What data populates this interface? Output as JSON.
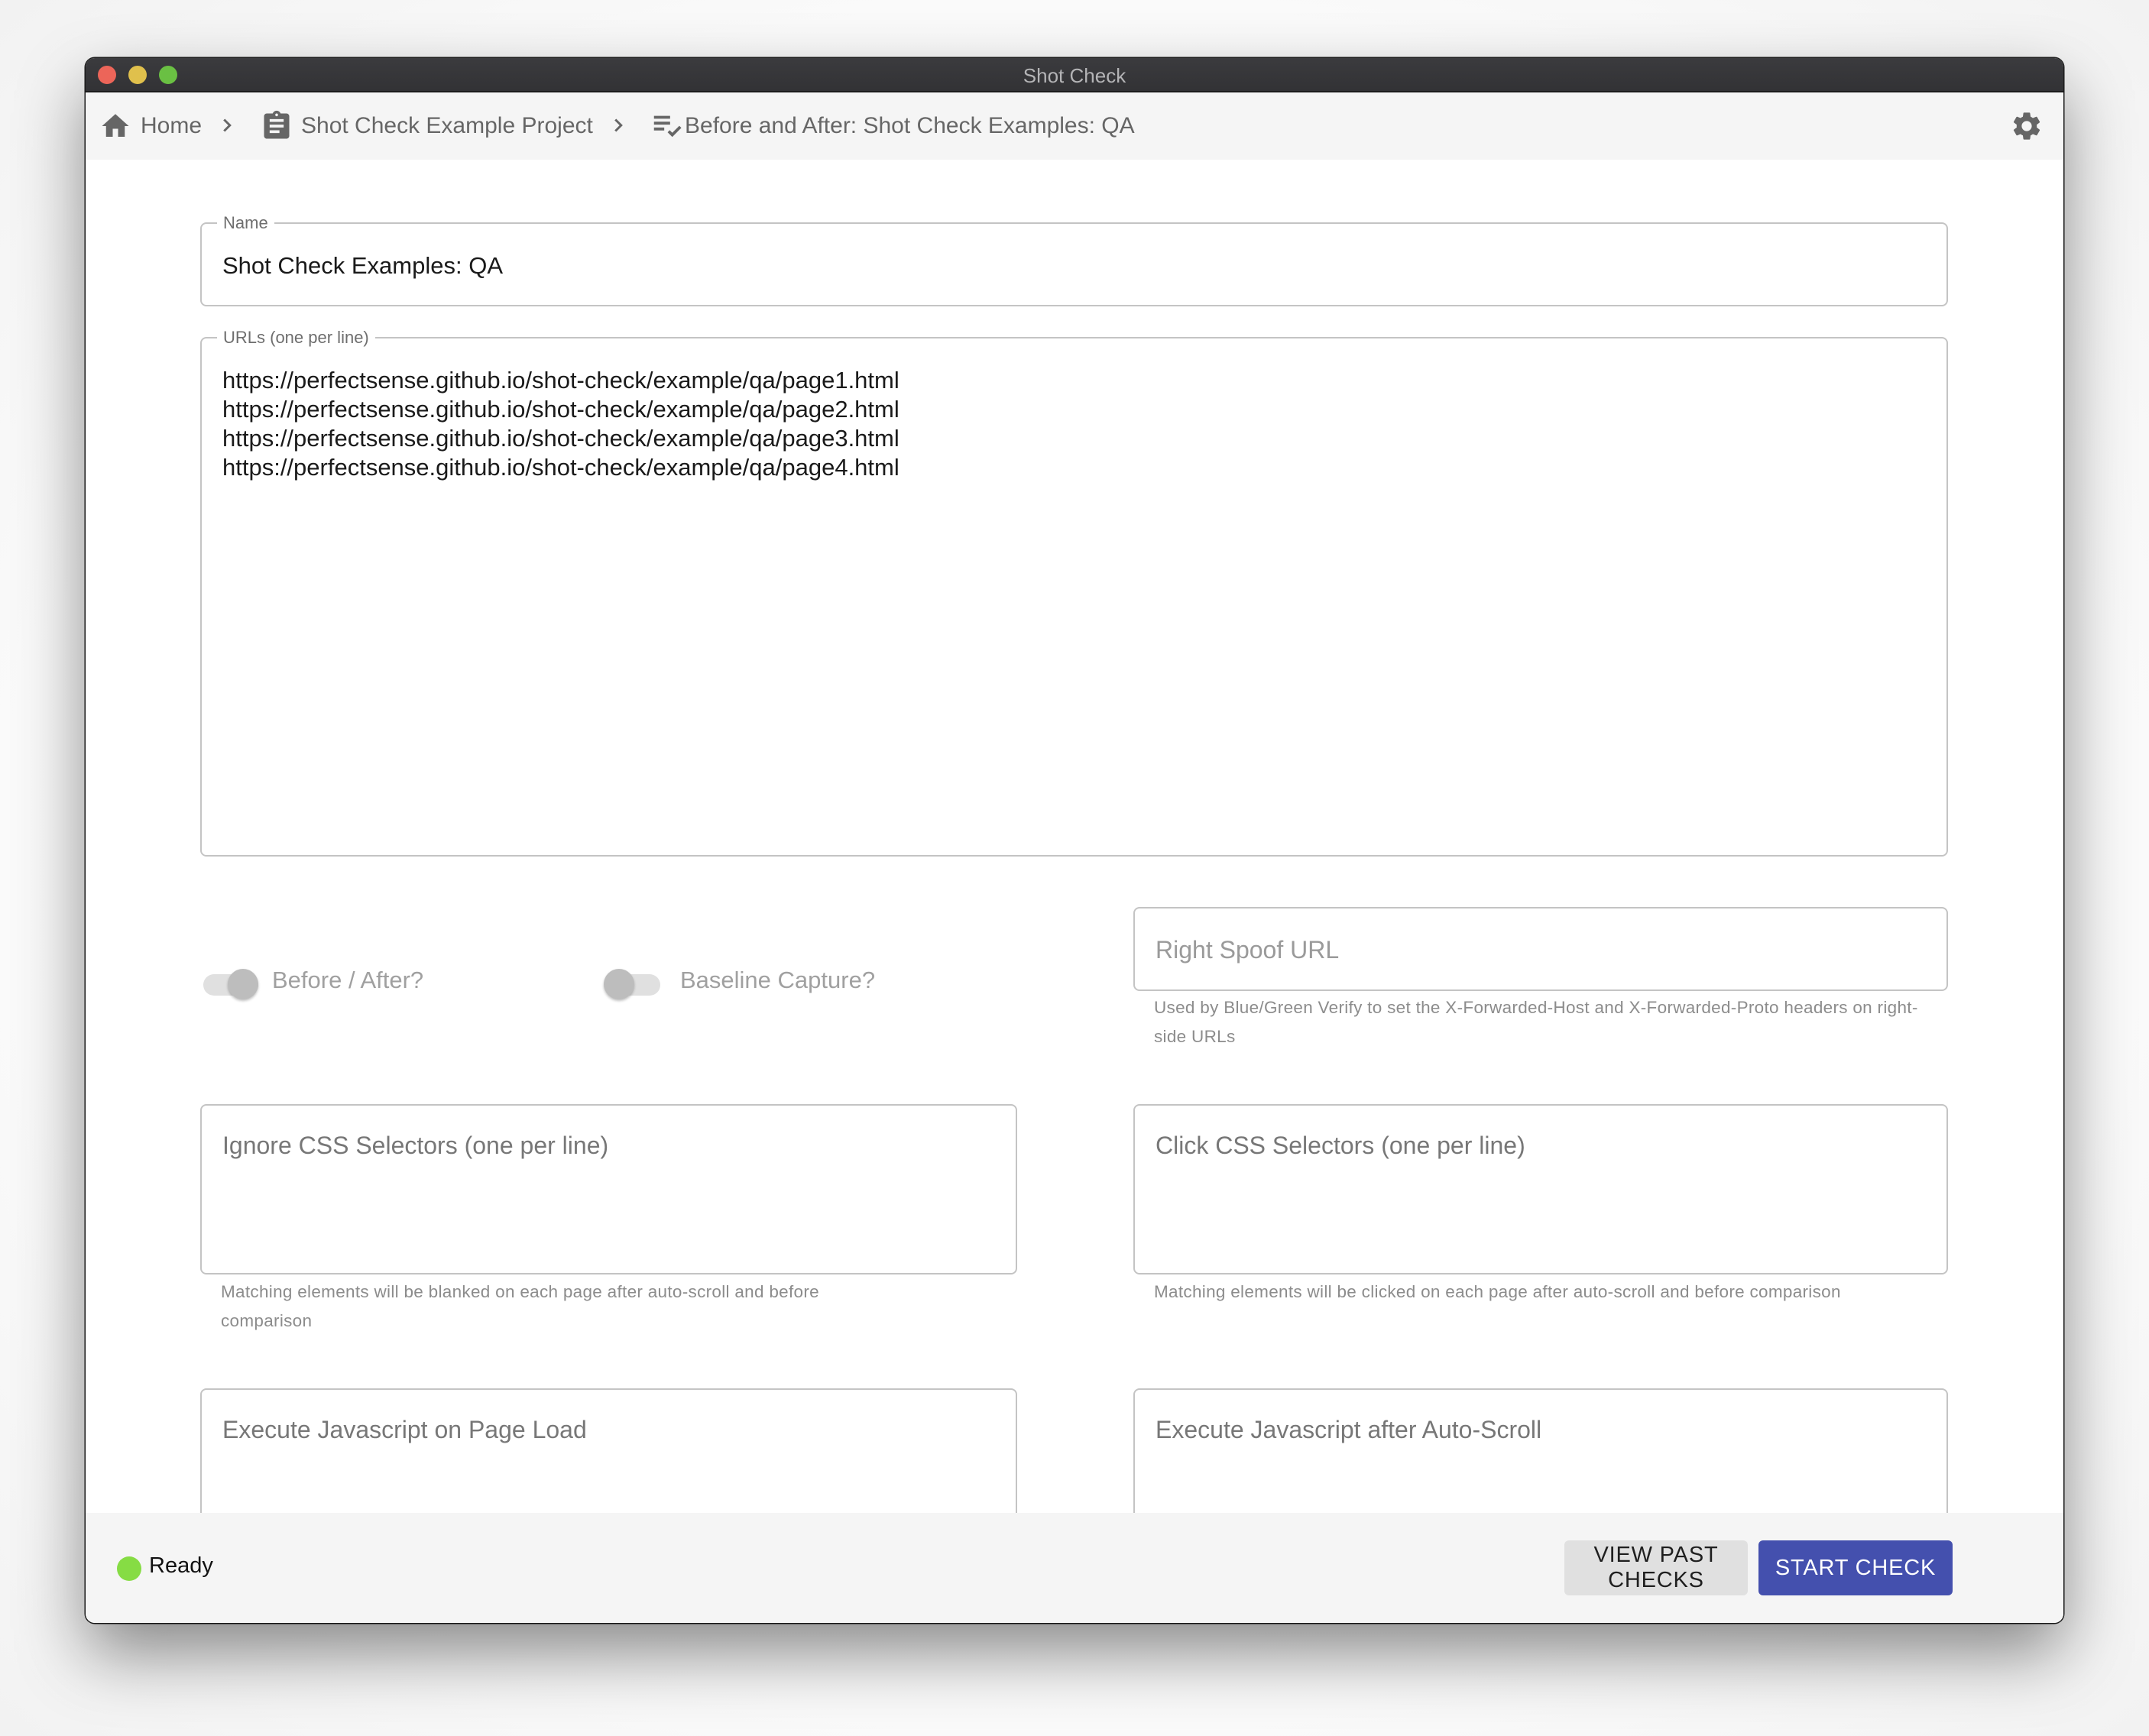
{
  "window": {
    "title": "Shot Check",
    "traffic_lights": [
      "close",
      "minimize",
      "maximize"
    ]
  },
  "breadcrumb": {
    "items": [
      {
        "label": "Home",
        "icon": "home-icon"
      },
      {
        "label": "Shot Check Example Project",
        "icon": "clipboard-icon"
      },
      {
        "label": "Before and After: Shot Check Examples: QA",
        "icon": "checklist-icon"
      }
    ],
    "separator_icon": "chevron-right-icon",
    "settings_icon": "gear-icon"
  },
  "form": {
    "name": {
      "label": "Name",
      "value": "Shot Check Examples: QA"
    },
    "urls": {
      "label": "URLs (one per line)",
      "value": "https://perfectsense.github.io/shot-check/example/qa/page1.html\nhttps://perfectsense.github.io/shot-check/example/qa/page2.html\nhttps://perfectsense.github.io/shot-check/example/qa/page3.html\nhttps://perfectsense.github.io/shot-check/example/qa/page4.html"
    },
    "before_after": {
      "label": "Before / After?",
      "checked": true,
      "disabled": true
    },
    "baseline_capture": {
      "label": "Baseline Capture?",
      "checked": false,
      "disabled": true
    },
    "right_spoof_url": {
      "placeholder": "Right Spoof URL",
      "value": "",
      "helper": "Used by Blue/Green Verify to set the X-Forwarded-Host and X-Forwarded-Proto headers on right-side URLs"
    },
    "ignore_css_selectors": {
      "placeholder": "Ignore CSS Selectors (one per line)",
      "value": "",
      "helper": "Matching elements will be blanked on each page after auto-scroll and before comparison"
    },
    "click_css_selectors": {
      "placeholder": "Click CSS Selectors (one per line)",
      "value": "",
      "helper": "Matching elements will be clicked on each page after auto-scroll and before comparison"
    },
    "js_on_page_load": {
      "placeholder": "Execute Javascript on Page Load",
      "value": ""
    },
    "js_after_auto_scroll": {
      "placeholder": "Execute Javascript after Auto-Scroll",
      "value": ""
    }
  },
  "footer": {
    "status": {
      "text": "Ready",
      "color": "#86dc44"
    },
    "buttons": {
      "view_past_checks": "VIEW PAST CHECKS",
      "start_check": "START CHECK"
    },
    "primary_color": "#4450ae"
  }
}
